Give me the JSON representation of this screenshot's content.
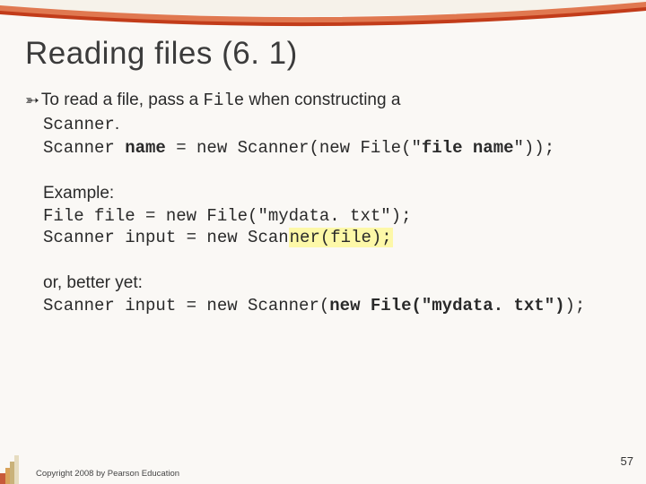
{
  "title": "Reading files (6. 1)",
  "bullet": {
    "lead": "To read a file, pass a ",
    "code1": "File",
    "mid": " when constructing a ",
    "code2": "Scanner",
    "period": "."
  },
  "syntax": {
    "pre": "Scanner ",
    "name": "name",
    "mid": " = new Scanner(new File(\"",
    "file": "file name",
    "post": "\"));"
  },
  "example_label": "Example:",
  "example_line1": "File file = new File(\"mydata. txt\");",
  "example_line2a": "Scanner input = new Scan",
  "example_line2b": "ner(file);",
  "better_label": "or, better yet:",
  "better_pre": "Scanner input = new Scanner(",
  "better_new": "new File(\"mydata. txt\")",
  "better_post": ");",
  "footer": "Copyright 2008 by Pearson Education",
  "page": "57"
}
